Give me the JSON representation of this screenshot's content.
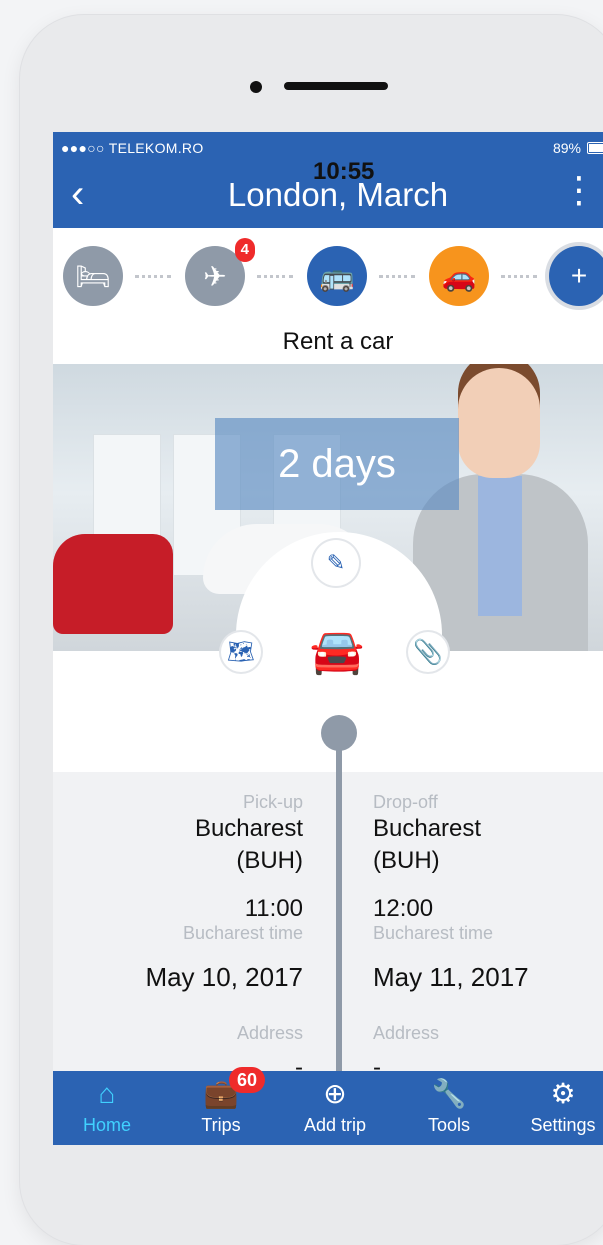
{
  "status_bar": {
    "carrier": "●●●○○ TELEKOM.RO",
    "time": "10:55",
    "battery": "89%"
  },
  "nav": {
    "title": "London, March",
    "back_icon": "chevron-left-icon",
    "more_icon": "more-vertical-icon"
  },
  "steps": {
    "flight_badge": "4",
    "colors": {
      "inactive": "#8f9aa8",
      "bus": "#2b63b3",
      "car": "#f7941d",
      "plus": "#2b63b3"
    }
  },
  "section": {
    "title": "Rent a car"
  },
  "hero": {
    "duration": "2 days"
  },
  "pickup": {
    "label": "Pick-up",
    "city": "Bucharest",
    "code": "(BUH)",
    "time": "11:00",
    "tz": "Bucharest time",
    "date": "May 10, 2017",
    "address_label": "Address",
    "address": "-"
  },
  "dropoff": {
    "label": "Drop-off",
    "city": "Bucharest",
    "code": "(BUH)",
    "time": "12:00",
    "tz": "Bucharest time",
    "date": "May 11, 2017",
    "address_label": "Address",
    "address": "-"
  },
  "tabs": [
    {
      "label": "Home",
      "icon": "home-icon"
    },
    {
      "label": "Trips",
      "icon": "briefcase-icon",
      "badge": "60"
    },
    {
      "label": "Add trip",
      "icon": "plus-circle-icon"
    },
    {
      "label": "Tools",
      "icon": "wrench-icon"
    },
    {
      "label": "Settings",
      "icon": "gear-icon"
    }
  ]
}
